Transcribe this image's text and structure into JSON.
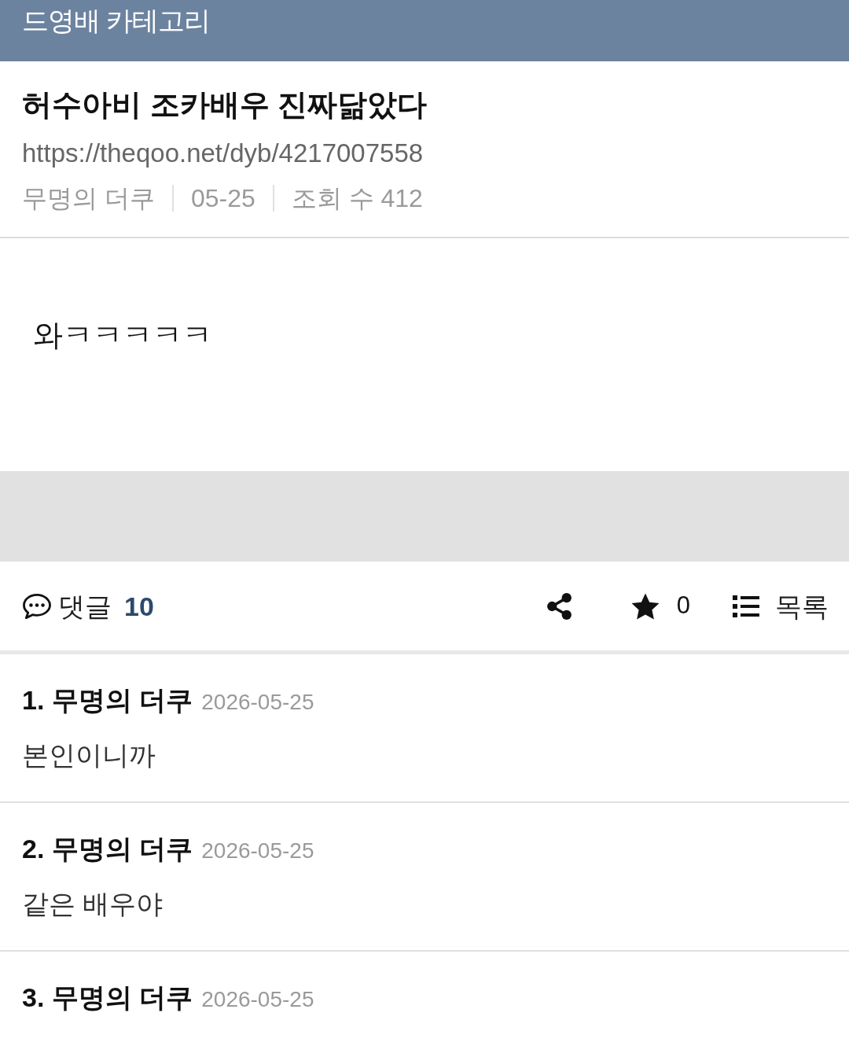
{
  "header": {
    "title": "드영배 카테고리"
  },
  "post": {
    "title": "허수아비 조카배우 진짜닮았다",
    "url": "https://theqoo.net/dyb/4217007558",
    "meta": [
      "무명의 더쿠",
      "05-25",
      "조회 수 412"
    ],
    "body": "와ㅋㅋㅋㅋㅋ"
  },
  "actions": {
    "comments_label": "댓글",
    "comments_count": "10",
    "star_count": "0",
    "list_label": "목록"
  },
  "comments": [
    {
      "author": "1. 무명의 더쿠",
      "date": "2026-05-25",
      "text": "본인이니까"
    },
    {
      "author": "2. 무명의 더쿠",
      "date": "2026-05-25",
      "text": "같은 배우야"
    },
    {
      "author": "3. 무명의 더쿠",
      "date": "2026-05-25"
    }
  ]
}
